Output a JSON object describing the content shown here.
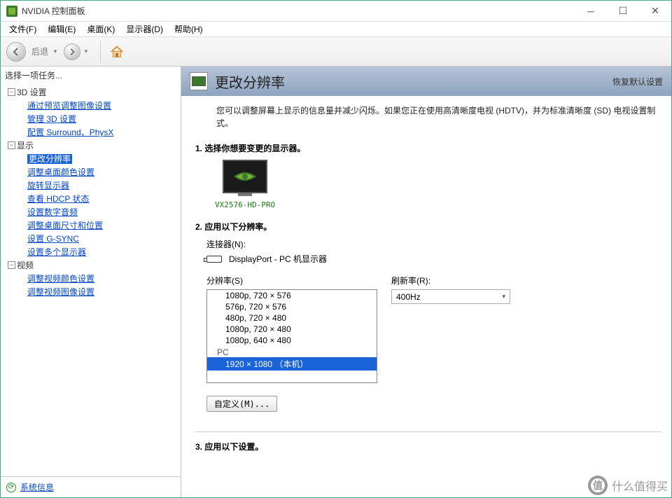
{
  "window": {
    "title": "NVIDIA 控制面板"
  },
  "menu": {
    "file": "文件(F)",
    "edit": "编辑(E)",
    "desktop": "桌面(K)",
    "display": "显示器(D)",
    "help": "帮助(H)"
  },
  "toolbar": {
    "back_label": "后退"
  },
  "sidebar": {
    "header": "选择一项任务...",
    "groups": [
      {
        "label": "3D 设置",
        "items": [
          "通过预览调整图像设置",
          "管理 3D 设置",
          "配置 Surround、PhysX"
        ]
      },
      {
        "label": "显示",
        "items": [
          "更改分辨率",
          "调整桌面颜色设置",
          "旋转显示器",
          "查看 HDCP 状态",
          "设置数字音频",
          "调整桌面尺寸和位置",
          "设置 G-SYNC",
          "设置多个显示器"
        ]
      },
      {
        "label": "视频",
        "items": [
          "调整视频颜色设置",
          "调整视频图像设置"
        ]
      }
    ],
    "selected": "更改分辨率",
    "system_info": "系统信息"
  },
  "main": {
    "title": "更改分辨率",
    "restore": "恢复默认设置",
    "intro": "您可以调整屏幕上显示的信息量并减少闪烁。如果您正在使用高清晰度电视 (HDTV)，并为标准清晰度 (SD) 电视设置制式。",
    "s1_title": "1.  选择你想要变更的显示器。",
    "monitor_name": "VX2576-HD-PRO",
    "s2_title": "2.  应用以下分辨率。",
    "connector_label": "连接器(N):",
    "connector_value": "DisplayPort - PC 机显示器",
    "resolution_label": "分辨率(S)",
    "refresh_label": "刷新率(R):",
    "refresh_value": "400Hz",
    "resolutions": [
      "1080p, 720 × 576",
      "576p, 720 × 576",
      "480p, 720 × 480",
      "1080p, 720 × 480",
      "1080p, 640 × 480"
    ],
    "res_group": "PC",
    "res_selected": "1920 × 1080 （本机）",
    "custom_btn": "自定义(M)...",
    "s3_title": "3.  应用以下设置。"
  },
  "watermark": "什么值得买"
}
